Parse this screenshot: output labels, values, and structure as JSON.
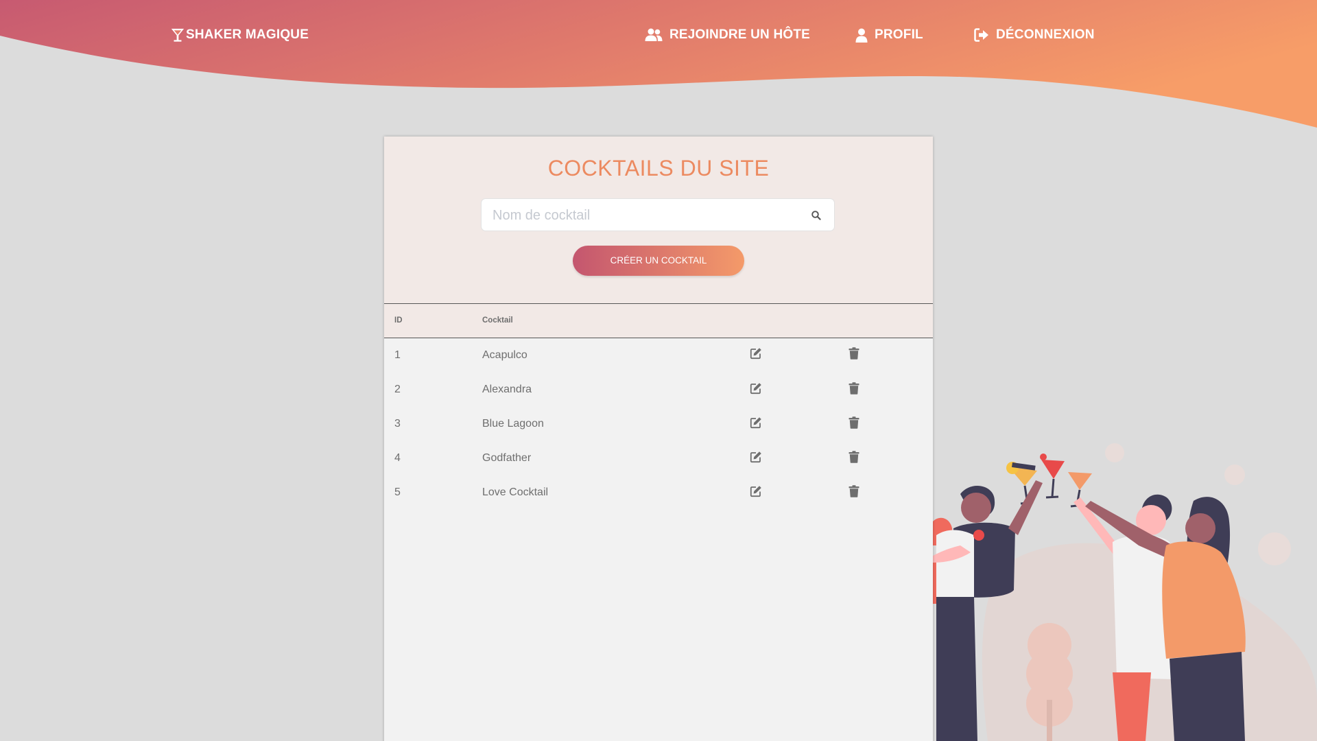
{
  "nav": {
    "brand": "SHAKER MAGIQUE",
    "links": [
      {
        "label": "REJOINDRE UN HÔTE",
        "icon": "users-icon"
      },
      {
        "label": "PROFIL",
        "icon": "user-icon"
      },
      {
        "label": "DÉCONNEXION",
        "icon": "sign-out-icon"
      }
    ]
  },
  "colors": {
    "header_gradient_start": "#c4566f",
    "header_gradient_end": "#f49a69",
    "title": "#ec8a60",
    "background": "#dcdcdc"
  },
  "main": {
    "title": "COCKTAILS DU SITE",
    "search": {
      "placeholder": "Nom de cocktail",
      "value": ""
    },
    "create_button": "CRÉER UN COCKTAIL",
    "table": {
      "columns": [
        "ID",
        "Cocktail"
      ],
      "rows": [
        {
          "id": "1",
          "name": "Acapulco"
        },
        {
          "id": "2",
          "name": "Alexandra"
        },
        {
          "id": "3",
          "name": "Blue Lagoon"
        },
        {
          "id": "4",
          "name": "Godfather"
        },
        {
          "id": "5",
          "name": "Love Cocktail"
        }
      ]
    }
  }
}
